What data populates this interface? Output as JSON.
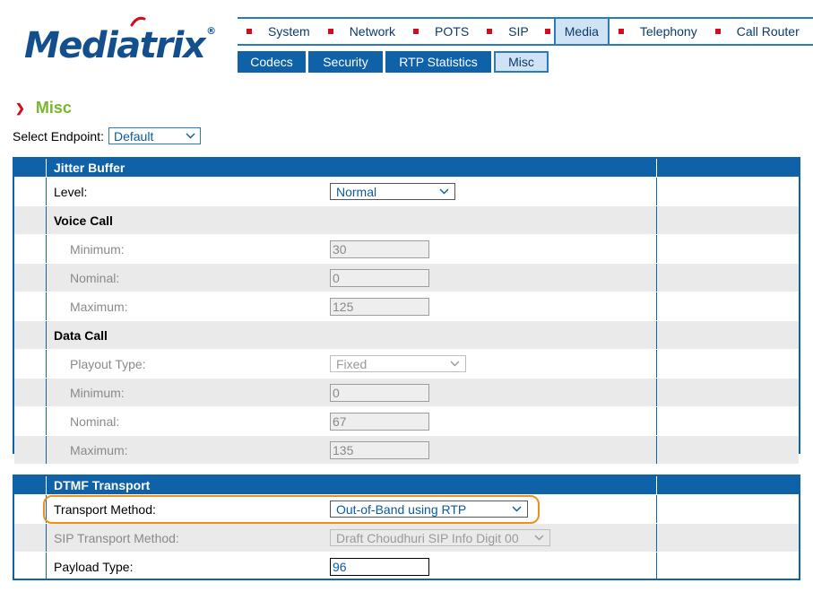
{
  "brand": {
    "name": "Mediatrix",
    "reg": "®"
  },
  "topnav": [
    {
      "label": "System",
      "active": false
    },
    {
      "label": "Network",
      "active": false
    },
    {
      "label": "POTS",
      "active": false
    },
    {
      "label": "SIP",
      "active": false
    },
    {
      "label": "Media",
      "active": true
    },
    {
      "label": "Telephony",
      "active": false
    },
    {
      "label": "Call Router",
      "active": false
    }
  ],
  "subnav": [
    {
      "label": "Codecs",
      "active": false
    },
    {
      "label": "Security",
      "active": false
    },
    {
      "label": "RTP Statistics",
      "active": false
    },
    {
      "label": "Misc",
      "active": true
    }
  ],
  "page": {
    "title": "Misc"
  },
  "endpoint": {
    "label": "Select Endpoint:",
    "value": "Default"
  },
  "jitter": {
    "title": "Jitter Buffer",
    "level_label": "Level:",
    "level_value": "Normal",
    "voice_title": "Voice Call",
    "voice_min_label": "Minimum:",
    "voice_min": "30",
    "voice_nom_label": "Nominal:",
    "voice_nom": "0",
    "voice_max_label": "Maximum:",
    "voice_max": "125",
    "data_title": "Data Call",
    "playout_label": "Playout Type:",
    "playout_value": "Fixed",
    "data_min_label": "Minimum:",
    "data_min": "0",
    "data_nom_label": "Nominal:",
    "data_nom": "67",
    "data_max_label": "Maximum:",
    "data_max": "135"
  },
  "dtmf": {
    "title": "DTMF Transport",
    "method_label": "Transport Method:",
    "method_value": "Out-of-Band using RTP",
    "sip_label": "SIP Transport Method:",
    "sip_value": "Draft Choudhuri SIP Info Digit 00",
    "payload_label": "Payload Type:",
    "payload_value": "96"
  },
  "colors": {
    "brand_blue": "#124f8c",
    "header_blue": "#0f62a8",
    "accent_green": "#76b82a",
    "bullet_red": "#d20b1d",
    "highlight_orange": "#f09018"
  }
}
